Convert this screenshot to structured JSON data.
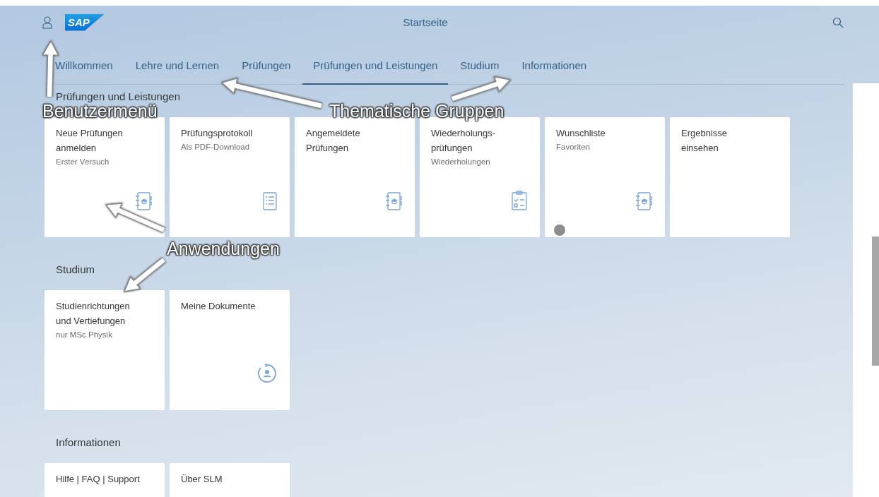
{
  "header": {
    "logo": "SAP",
    "title": "Startseite"
  },
  "tabs": [
    {
      "label": "Willkommen",
      "selected": false
    },
    {
      "label": "Lehre und Lernen",
      "selected": false
    },
    {
      "label": "Prüfungen",
      "selected": false
    },
    {
      "label": "Prüfungen und Leistungen",
      "selected": true
    },
    {
      "label": "Studium",
      "selected": false
    },
    {
      "label": "Informationen",
      "selected": false
    }
  ],
  "groups": [
    {
      "title": "Prüfungen und Leistungen",
      "tiles": [
        {
          "kind": "notebook",
          "title": "Neue Prüfungen\nanmelden",
          "subtitle": "Erster Versuch",
          "indicator": false
        },
        {
          "kind": "list",
          "title": "Prüfungsprotokoll",
          "subtitle": "Als PDF-Download",
          "indicator": false
        },
        {
          "kind": "notebook",
          "title": "Angemeldete\nPrüfungen",
          "indicator": false
        },
        {
          "kind": "checklist",
          "title": "Wiederholungs-\nprüfungen",
          "subtitle": "Wiederholungen",
          "indicator": false
        },
        {
          "kind": "notebook",
          "title": "Wunschliste",
          "subtitle": "Favoriten",
          "indicator": true
        },
        {
          "kind": "plain",
          "title": "Ergebnisse\neinsehen",
          "indicator": false
        }
      ]
    },
    {
      "title": "Studium",
      "tiles": [
        {
          "kind": "plain",
          "title": "Studienrichtungen\nund Vertiefungen",
          "subtitle": "nur MSc Physik"
        },
        {
          "kind": "person-sync",
          "title": "Meine Dokumente"
        }
      ]
    },
    {
      "title": "Informationen",
      "tiles": [
        {
          "kind": "plain",
          "title": "Hilfe | FAQ | Support"
        },
        {
          "kind": "plain",
          "title": "Über SLM"
        }
      ]
    }
  ],
  "annotations": [
    {
      "label": "Benutzermenü"
    },
    {
      "label": "Thematische Gruppen"
    },
    {
      "label": "Anwendungen"
    }
  ]
}
